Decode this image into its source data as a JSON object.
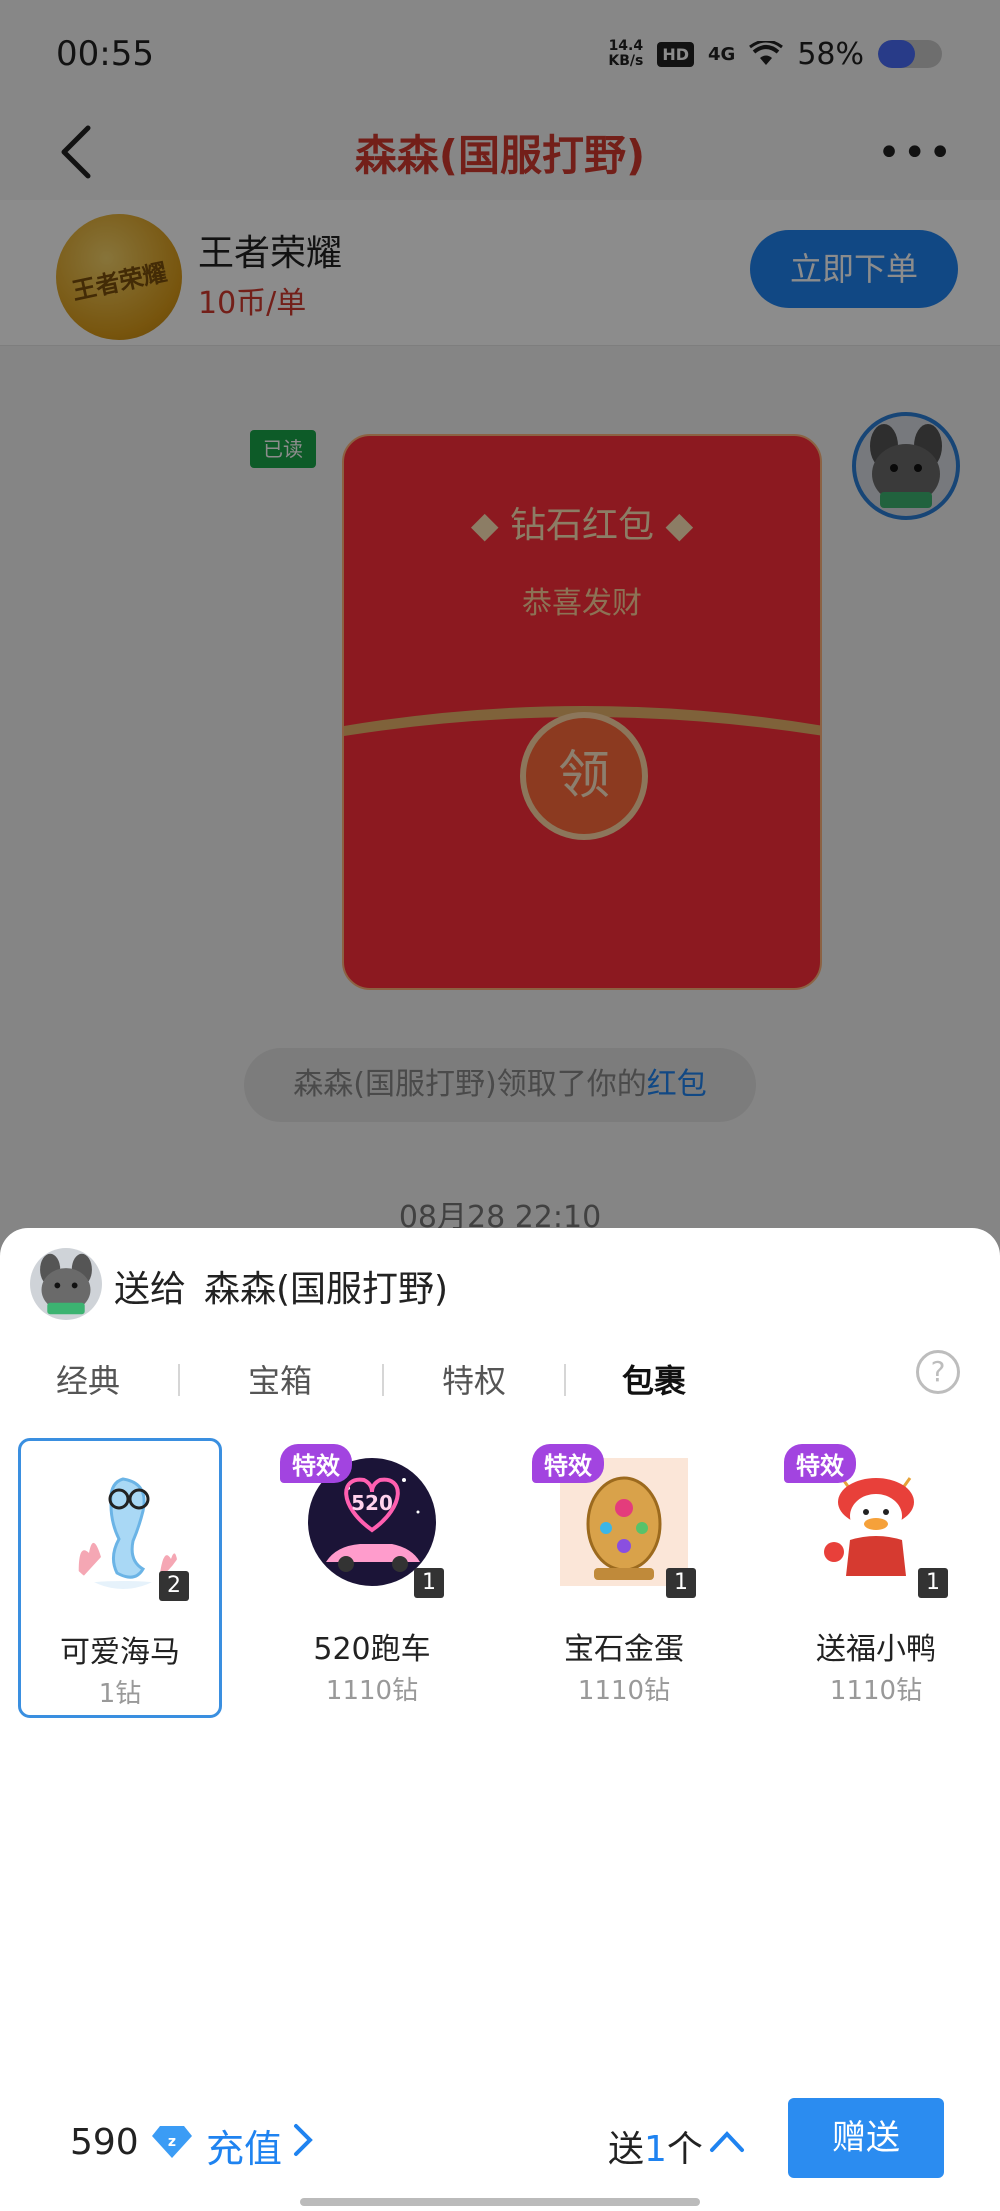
{
  "status_bar": {
    "time": "00:55",
    "net_speed_value": "14.4",
    "net_speed_unit": "KB/s",
    "hd": "HD",
    "network": "4G",
    "battery": "58%",
    "battery_level": 0.58
  },
  "nav": {
    "title": "森森(国服打野)"
  },
  "game_card": {
    "logo_text": "王者荣耀",
    "name": "王者荣耀",
    "price": "10币/单",
    "order_button": "立即下单"
  },
  "chat": {
    "read_badge": "已读",
    "red_packet": {
      "title": "钻石红包",
      "subtitle": "恭喜发财",
      "open_label": "领"
    },
    "system_tip_prefix": "森森(国服打野)领取了你的",
    "system_tip_link": "红包",
    "timestamp": "08月28 22:10"
  },
  "sheet": {
    "send_to_label": "送给",
    "recipient": "森森(国服打野)",
    "tabs": [
      "经典",
      "宝箱",
      "特权",
      "包裹"
    ],
    "active_tab": "包裹",
    "help_icon": "?",
    "gifts": [
      {
        "name": "可爱海马",
        "price": "1钻",
        "count": "2",
        "effect_badge": ""
      },
      {
        "name": "520跑车",
        "price": "1110钻",
        "count": "1",
        "effect_badge": "特效",
        "image_text": "520"
      },
      {
        "name": "宝石金蛋",
        "price": "1110钻",
        "count": "1",
        "effect_badge": "特效"
      },
      {
        "name": "送福小鸭",
        "price": "1110钻",
        "count": "1",
        "effect_badge": "特效"
      }
    ],
    "footer": {
      "balance": "590",
      "recharge": "充值",
      "qty_prefix": "送",
      "qty_value": "1",
      "qty_suffix": "个",
      "send_button": "赠送"
    }
  },
  "colors": {
    "accent_blue": "#1f83f0",
    "title_red": "#d23a2e",
    "effect_purple": "#a244e0"
  }
}
